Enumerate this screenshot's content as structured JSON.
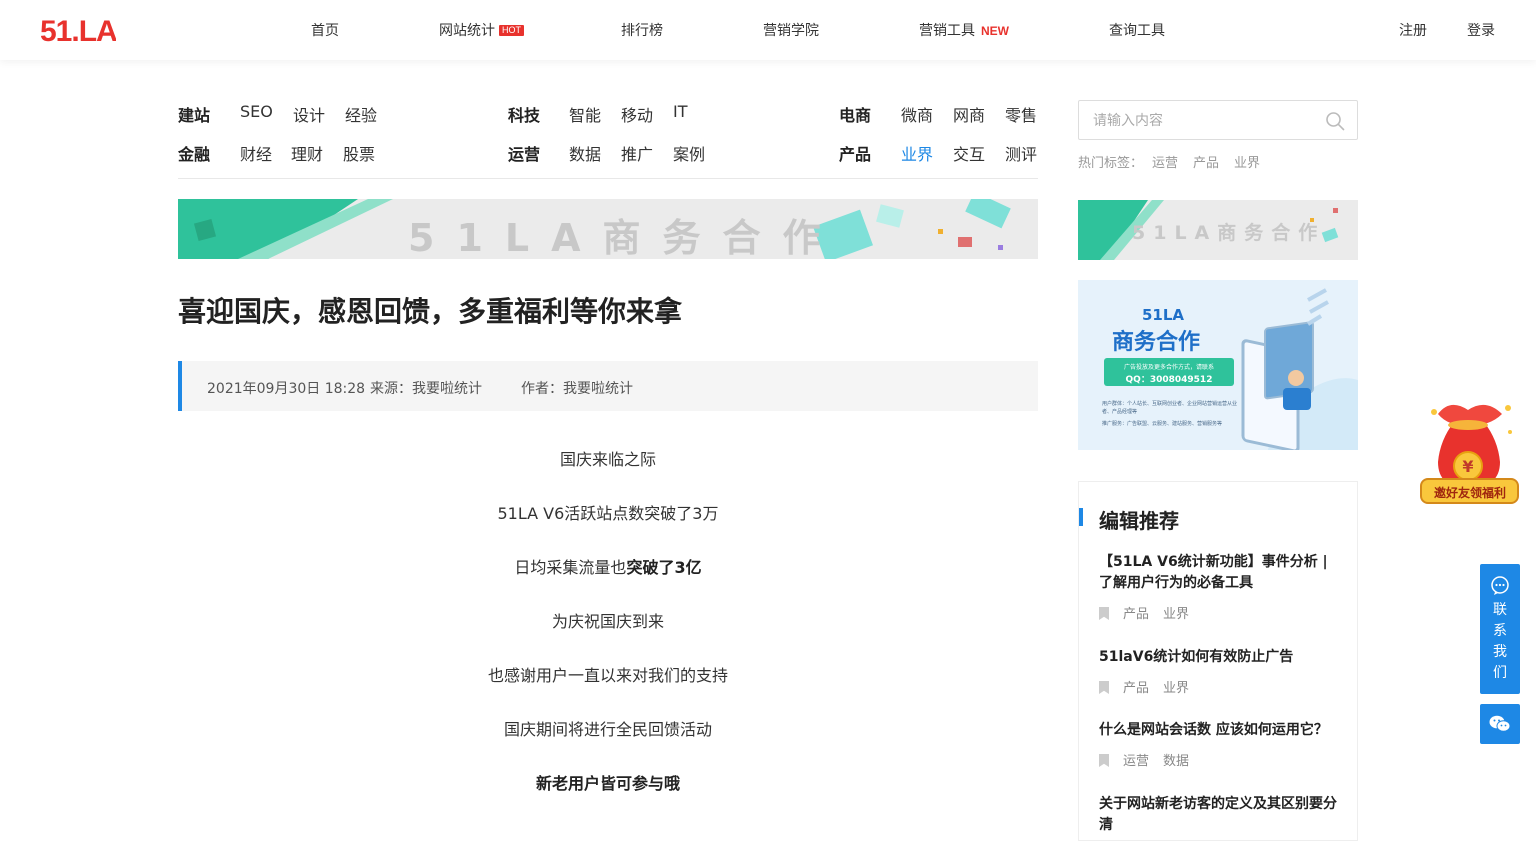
{
  "header": {
    "logo": "51.LA",
    "nav": [
      {
        "label": "首页"
      },
      {
        "label": "网站统计",
        "badge": "HOT"
      },
      {
        "label": "排行榜"
      },
      {
        "label": "营销学院"
      },
      {
        "label": "营销工具",
        "badge": "NEW"
      },
      {
        "label": "查询工具"
      }
    ],
    "register": "注册",
    "login": "登录"
  },
  "categories": [
    {
      "label": "建站",
      "links": [
        "SEO",
        "设计",
        "经验"
      ]
    },
    {
      "label": "金融",
      "links": [
        "财经",
        "理财",
        "股票"
      ]
    },
    {
      "label": "科技",
      "links": [
        "智能",
        "移动",
        "IT"
      ]
    },
    {
      "label": "运营",
      "links": [
        "数据",
        "推广",
        "案例"
      ]
    },
    {
      "label": "电商",
      "links": [
        "微商",
        "网商",
        "零售"
      ]
    },
    {
      "label": "产品",
      "links": [
        "业界",
        "交互",
        "测评"
      ],
      "active": "业界"
    }
  ],
  "banner": {
    "text": "51LA商务合作"
  },
  "article": {
    "title": "喜迎国庆，感恩回馈，多重福利等你来拿",
    "date": "2021年09月30日 18:28",
    "source": "来源：我要啦统计",
    "author": "作者：我要啦统计",
    "paragraphs": [
      {
        "text": "国庆来临之际"
      },
      {
        "text": "51LA V6活跃站点数突破了3万"
      },
      {
        "text": "日均采集流量也",
        "bold": "突破了3亿"
      },
      {
        "text": "为庆祝国庆到来"
      },
      {
        "text": "也感谢用户一直以来对我们的支持"
      },
      {
        "text": "国庆期间将进行全民回馈活动"
      },
      {
        "text": "",
        "bold": "新老用户皆可参与哦"
      }
    ]
  },
  "search": {
    "placeholder": "请输入内容",
    "hot_label": "热门标签：",
    "hot_tags": [
      "运营",
      "产品",
      "业界"
    ]
  },
  "ad_card": {
    "brand": "51LA",
    "title": "商务合作",
    "line1": "广告投放及更多合作方式，请联系",
    "qq": "QQ：3008049512",
    "desc1": "用户群体：个人站长、互联网创业者、企业网站营销运营从业者、产品经理等",
    "desc2": "推广服务：广告联盟、云服务、建站服务、营销服务等"
  },
  "recommend": {
    "heading": "编辑推荐",
    "items": [
      {
        "title": "【51LA V6统计新功能】事件分析 | 了解用户行为的必备工具",
        "tags": [
          "产品",
          "业界"
        ]
      },
      {
        "title": "51laV6统计如何有效防止广告",
        "tags": [
          "产品",
          "业界"
        ]
      },
      {
        "title": "什么是网站会话数 应该如何运用它？",
        "tags": [
          "运营",
          "数据"
        ]
      },
      {
        "title": "关于网站新老访客的定义及其区别要分清",
        "tags": []
      }
    ]
  },
  "float": {
    "gift_label": "邀好友领福利",
    "contact": "联系我们",
    "contact_chars": [
      "联",
      "系",
      "我",
      "们"
    ],
    "colors": {
      "accent": "#1e88e5",
      "brand": "#e8322d"
    }
  }
}
